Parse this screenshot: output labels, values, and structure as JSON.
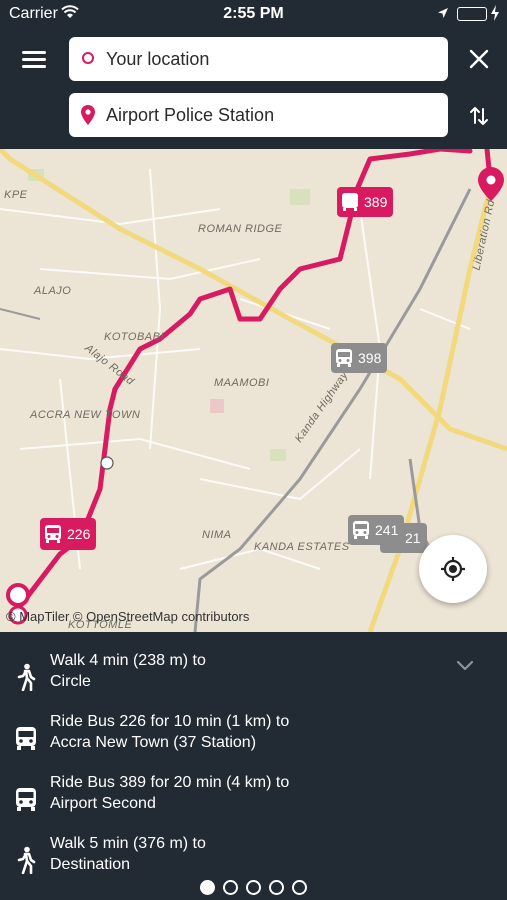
{
  "status_bar": {
    "carrier": "Carrier",
    "time": "2:55 PM",
    "battery_color": "#4cd964"
  },
  "header": {
    "menu_icon": "hamburger-menu-icon",
    "from_field": {
      "value": "Your location",
      "icon": "origin-ring-icon"
    },
    "to_field": {
      "value": "Airport Police Station",
      "icon": "destination-pin-icon"
    },
    "close_icon": "close-icon",
    "swap_icon": "swap-arrows-icon"
  },
  "map": {
    "place_labels": [
      "KPE",
      "ROMAN RIDGE",
      "ALAJO",
      "KOTOBABI",
      "Alajo Road",
      "ACCRA NEW TOWN",
      "MAAMOBI",
      "Kanda Highway",
      "NIMA",
      "KANDA ESTATES",
      "Liberation Rd",
      "KOTTOMLE"
    ],
    "bus_markers": [
      {
        "number": "389",
        "state": "active"
      },
      {
        "number": "398",
        "state": "inactive"
      },
      {
        "number": "226",
        "state": "active"
      },
      {
        "number": "241",
        "state": "inactive"
      },
      {
        "number": "21",
        "state": "inactive"
      }
    ],
    "attribution": "© MapTiler © OpenStreetMap contributors",
    "route_color": "#d81b60",
    "locate_icon": "locate-crosshair-icon"
  },
  "directions": {
    "steps": [
      {
        "icon": "walk-icon",
        "line1": "Walk 4 min (238 m) to",
        "line2": "Circle"
      },
      {
        "icon": "bus-icon",
        "line1": "Ride Bus 226 for 10 min (1 km) to",
        "line2": "Accra New Town (37 Station)"
      },
      {
        "icon": "bus-icon",
        "line1": "Ride Bus 389 for 20 min (4 km) to",
        "line2": "Airport Second"
      },
      {
        "icon": "walk-icon",
        "line1": "Walk 5 min (376 m) to",
        "line2": "Destination"
      }
    ],
    "collapse_icon": "chevron-down-icon",
    "pages": {
      "total": 5,
      "current": 1
    }
  }
}
